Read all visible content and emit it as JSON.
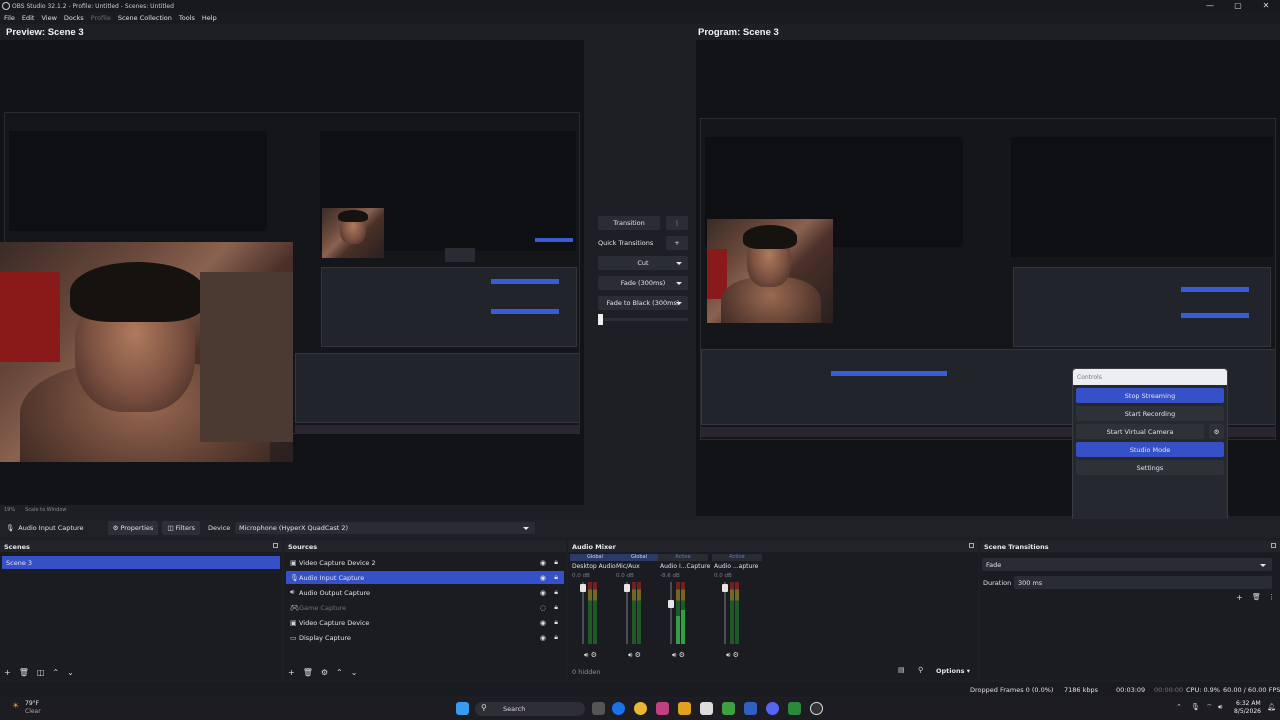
{
  "window": {
    "title": "OBS Studio 32.1.2 - Profile: Untitled - Scenes: Untitled",
    "controls": [
      "—",
      "▢",
      "✕"
    ]
  },
  "menu": [
    "File",
    "Edit",
    "View",
    "Docks",
    "Profile",
    "Scene Collection",
    "Tools",
    "Help"
  ],
  "preview": {
    "title": "Preview: Scene 3",
    "zoom": "19%",
    "scale_mode": "Scale to Window"
  },
  "program": {
    "title": "Program: Scene 3"
  },
  "transition_ctl": {
    "transition": "Transition",
    "quick": "Quick Transitions",
    "cut": "Cut",
    "fade": "Fade (300ms)",
    "fade_black": "Fade to Black (300ms)"
  },
  "controls_popup": {
    "header": "Controls",
    "stop_streaming": "Stop Streaming",
    "start_recording": "Start Recording",
    "start_virtual_camera": "Start Virtual Camera",
    "studio_mode": "Studio Mode",
    "settings": "Settings"
  },
  "source_toolbar": {
    "source_name": "Audio Input Capture",
    "properties": "Properties",
    "filters": "Filters",
    "device_label": "Device",
    "device_value": "Microphone (HyperX QuadCast 2)"
  },
  "scenes": {
    "title": "Scenes",
    "items": [
      "Scene 3"
    ]
  },
  "sources": {
    "title": "Sources",
    "items": [
      {
        "label": "Video Capture Device 2",
        "icon": "camera-icon"
      },
      {
        "label": "Audio Input Capture",
        "icon": "mic-icon"
      },
      {
        "label": "Audio Output Capture",
        "icon": "speaker-icon"
      },
      {
        "label": "Game Capture",
        "icon": "gamepad-icon"
      },
      {
        "label": "Video Capture Device",
        "icon": "camera-icon"
      },
      {
        "label": "Display Capture",
        "icon": "monitor-icon"
      }
    ]
  },
  "mixer": {
    "title": "Audio Mixer",
    "channels": [
      {
        "tag": "Global",
        "name": "Desktop Audio",
        "db": "0.0 dB"
      },
      {
        "tag": "Global",
        "name": "Mic/Aux",
        "db": "0.0 dB"
      },
      {
        "tag": "Active",
        "name": "Audio I...Capture",
        "db": "-8.6 dB"
      },
      {
        "tag": "Active",
        "name": "Audio ...apture",
        "db": "0.0 dB"
      }
    ],
    "hidden": "0 hidden",
    "options": "Options"
  },
  "transitions": {
    "title": "Scene Transitions",
    "selected": "Fade",
    "duration_label": "Duration",
    "duration_value": "300 ms"
  },
  "status": {
    "dropped": "Dropped Frames 0 (0.0%)",
    "kbps": "7186 kbps",
    "stream_time": "00:03:09",
    "rec_time": "00:00:00",
    "cpu": "CPU: 0.9%",
    "fps": "60.00 / 60.00 FPS"
  },
  "taskbar": {
    "weather_temp": "79°F",
    "weather_desc": "Clear",
    "search": "Search",
    "time": "6:32 AM",
    "date": "8/5/2026"
  },
  "colors": {
    "accent": "#3650c8",
    "bg": "#1e1f24",
    "dock": "#1b1c21"
  }
}
